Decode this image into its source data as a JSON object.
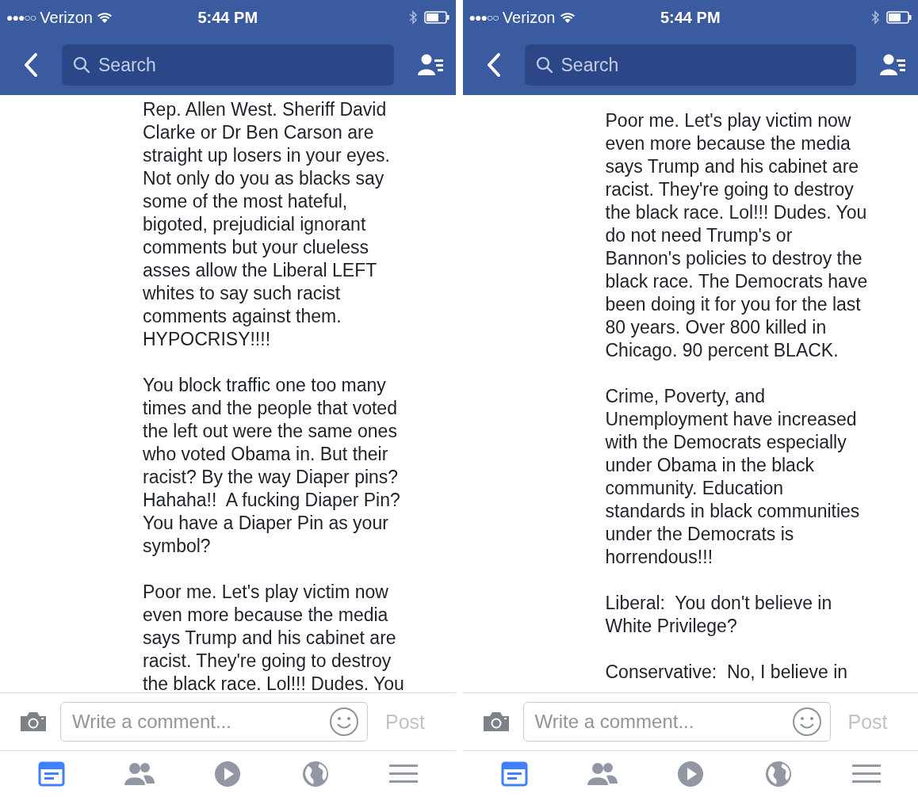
{
  "panels": [
    {
      "status_bar": {
        "signal": "●●●○○",
        "carrier": "Verizon",
        "time": "5:44 PM"
      },
      "search": {
        "placeholder": "Search"
      },
      "paragraphs": [
        {
          "lines": [
            "Rep. Allen West. Sheriff David",
            "Clarke or Dr Ben Carson are",
            "straight up losers in your eyes.",
            "Not only do you as blacks say",
            "some of the most hateful,",
            "bigoted, prejudicial ignorant",
            "comments but your clueless",
            "asses allow the Liberal LEFT",
            "whites to say such racist",
            "comments against them.",
            "HYPOCRISY!!!!"
          ]
        },
        {
          "lines": [
            "You block traffic one too many",
            "times and the people that voted",
            "the left out were the same ones",
            "who voted Obama in. But their",
            "racist? By the way Diaper pins?",
            "Hahaha!!  A fucking Diaper Pin?",
            "You have a Diaper Pin as your",
            "symbol?"
          ]
        },
        {
          "lines": [
            "Poor me. Let's play victim now",
            "even more because the media",
            "says Trump and his cabinet are",
            "racist. They're going to destroy",
            "the black race. Lol!!! Dudes. You"
          ]
        }
      ],
      "comment_bar": {
        "placeholder": "Write a comment...",
        "post": "Post",
        "post_disabled": true
      },
      "tabs": [
        {
          "selected": true
        },
        {
          "selected": false
        },
        {
          "selected": false
        },
        {
          "selected": false
        },
        {
          "selected": false
        }
      ]
    },
    {
      "status_bar": {
        "signal": "●●●○○",
        "carrier": "Verizon",
        "time": "5:44 PM"
      },
      "search": {
        "placeholder": "Search"
      },
      "paragraphs": [
        {
          "lines": [
            "Poor me. Let's play victim now",
            "even more because the media",
            "says Trump and his cabinet are",
            "racist. They're going to destroy",
            "the black race. Lol!!! Dudes. You",
            "do not need Trump's or",
            "Bannon's policies to destroy the",
            "black race. The Democrats have",
            "been doing it for you for the last",
            "80 years. Over 800 killed in",
            "Chicago. 90 percent BLACK."
          ]
        },
        {
          "lines": [
            "Crime, Poverty, and",
            "Unemployment have increased",
            "with the Democrats especially",
            "under Obama in the black",
            "community. Education",
            "standards in black communities",
            "under the Democrats is",
            "horrendous!!!"
          ]
        },
        {
          "lines": [
            "Liberal:  You don't believe in",
            "White Privilege?"
          ]
        },
        {
          "lines": [
            "Conservative:  No, I believe in"
          ]
        }
      ],
      "comment_bar": {
        "placeholder": "Write a comment...",
        "post": "Post",
        "post_disabled": true
      },
      "tabs": [
        {
          "selected": true
        },
        {
          "selected": false
        },
        {
          "selected": false
        },
        {
          "selected": false
        },
        {
          "selected": false
        }
      ]
    }
  ]
}
